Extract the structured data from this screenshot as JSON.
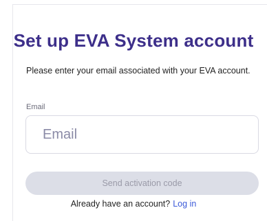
{
  "header": {
    "title": "Set up EVA System account",
    "subtitle": "Please enter your email associated with your EVA account."
  },
  "form": {
    "email_label": "Email",
    "email_placeholder": "Email",
    "email_value": "",
    "send_button_label": "Send activation code"
  },
  "footer": {
    "prompt": "Already have an account?",
    "login_link": "Log in"
  },
  "colors": {
    "title": "#3d2f8a",
    "link": "#3d5bd9",
    "button_disabled_bg": "#dcdee7",
    "button_disabled_text": "#9a9aa8"
  }
}
